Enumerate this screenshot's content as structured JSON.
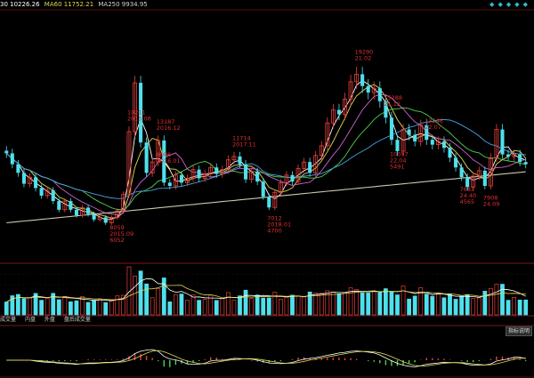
{
  "ma_legend": {
    "ma30": "30 10226.26",
    "ma60": "MA60 11752.21",
    "ma250": "MA250 9934.95"
  },
  "toolbar_icons": [
    "◆",
    "◆",
    "◆",
    "◆",
    "◆"
  ],
  "volume_tabs": [
    "成交量",
    "内盘",
    "外盘",
    "盘后成交量"
  ],
  "indicator_button": "指标说明",
  "colors": {
    "up": "#e8413c",
    "down": "#4fe0ec",
    "ma_white": "#ffffff",
    "ma_yellow": "#e0d850",
    "ma_magenta": "#d060d0",
    "ma_green": "#50d050",
    "ma_blue": "#4aa0e0",
    "ma250": "#c8c8b0",
    "label": "#e03030"
  },
  "annotations": [
    {
      "lines": [
        "10211",
        "2015.06"
      ],
      "i": 21,
      "pos": "above"
    },
    {
      "lines": [
        "13187",
        "2016.12"
      ],
      "i": 26,
      "pos": "above"
    },
    {
      "lines": [
        "8059",
        "2015.09",
        "6052"
      ],
      "i": 18,
      "pos": "below"
    },
    {
      "lines": [
        "8996",
        "2016.01"
      ],
      "i": 26,
      "pos": "below"
    },
    {
      "lines": [
        "11714",
        "2017.11"
      ],
      "i": 39,
      "pos": "above"
    },
    {
      "lines": [
        "7012",
        "2018.01",
        "4700"
      ],
      "i": 45,
      "pos": "below"
    },
    {
      "lines": [
        "19290",
        "21.02"
      ],
      "i": 60,
      "pos": "above"
    },
    {
      "lines": [
        "15288",
        "21.12"
      ],
      "i": 65,
      "pos": "above"
    },
    {
      "lines": [
        "13246",
        "22.07"
      ],
      "i": 72,
      "pos": "above"
    },
    {
      "lines": [
        "10097",
        "22.04",
        "5491"
      ],
      "i": 66,
      "pos": "below"
    },
    {
      "lines": [
        "7683",
        "24.40",
        "4565"
      ],
      "i": 78,
      "pos": "below"
    },
    {
      "lines": [
        "7908",
        "24.09"
      ],
      "i": 82,
      "pos": "below"
    }
  ],
  "chart_data": {
    "type": "candlestick",
    "ylim": [
      4000,
      24000
    ],
    "close": [
      12000,
      11000,
      10200,
      9200,
      9800,
      8800,
      8100,
      8600,
      7600,
      6800,
      7600,
      6800,
      6300,
      7000,
      6400,
      5900,
      6100,
      5600,
      6100,
      6700,
      8200,
      14000,
      18500,
      13000,
      10200,
      11200,
      13187,
      9300,
      8996,
      10000,
      9300,
      9700,
      10500,
      9700,
      10100,
      10700,
      10100,
      10500,
      11400,
      11714,
      11000,
      9600,
      10300,
      9400,
      8000,
      7012,
      8400,
      9300,
      10000,
      9400,
      10600,
      11200,
      10200,
      11800,
      12700,
      14800,
      16000,
      15600,
      17000,
      18600,
      19290,
      18200,
      17600,
      18000,
      16800,
      15288,
      13246,
      12200,
      14200,
      13700,
      13100,
      14600,
      13246,
      12800,
      13100,
      12500,
      11600,
      10700,
      9800,
      8900,
      9900,
      10400,
      9000,
      11600,
      14200,
      11900,
      11700,
      11900,
      11200,
      11000
    ],
    "ma30_value": 10226.26,
    "ma60_value": 11752.21,
    "ma250_value": 9934.95
  }
}
